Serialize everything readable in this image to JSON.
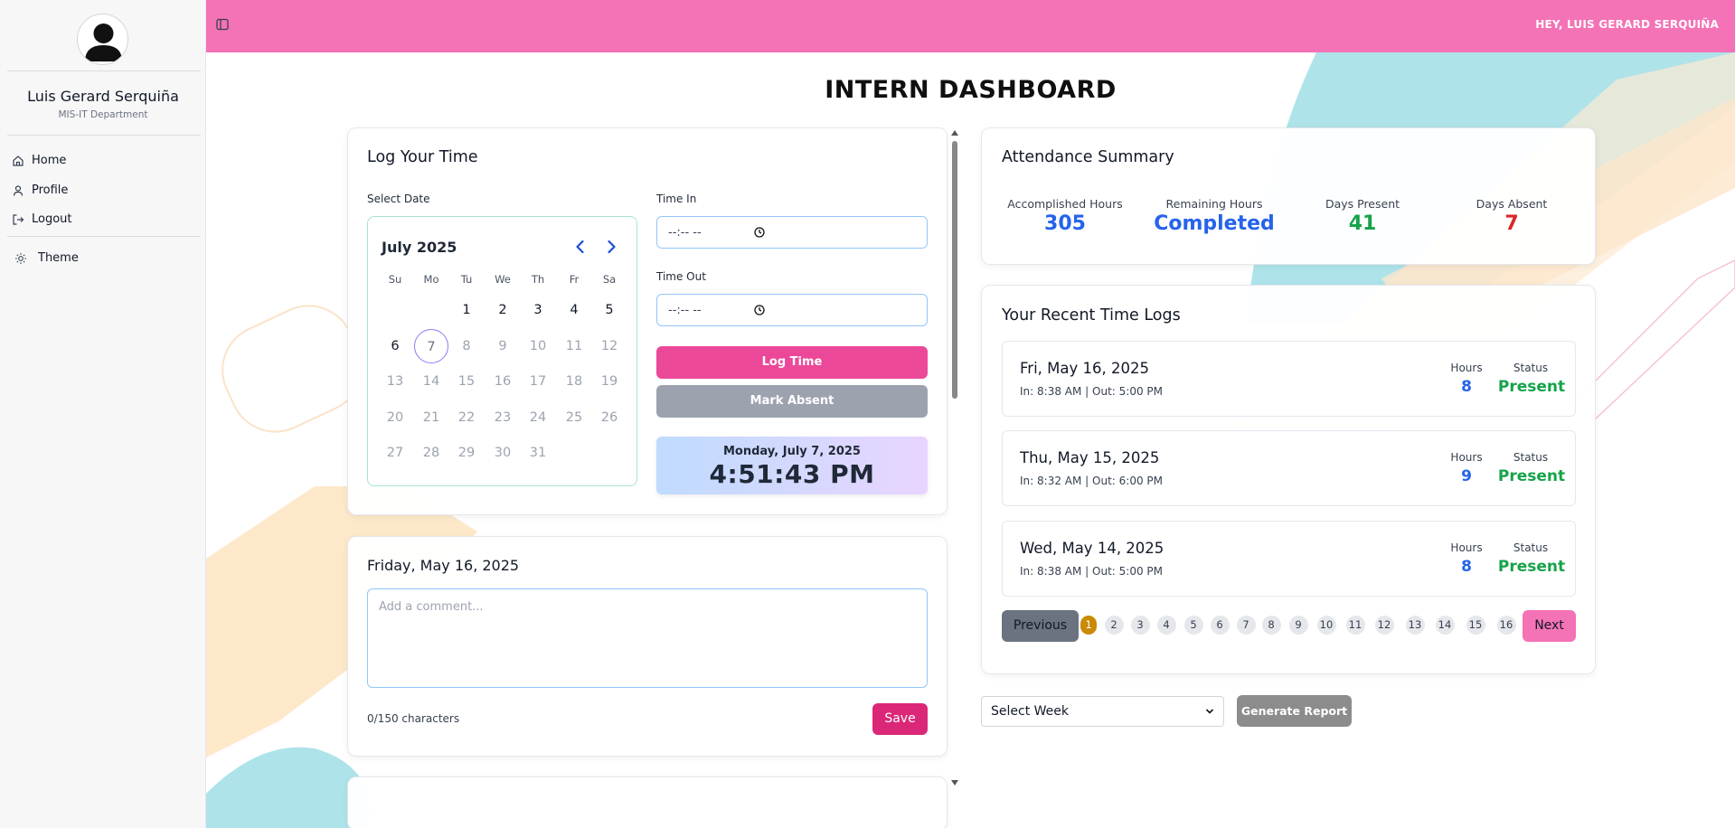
{
  "sidebar": {
    "user_name": "Luis Gerard Serquiña",
    "department": "MIS-IT Department",
    "nav": [
      {
        "label": "Home",
        "icon": "home-icon"
      },
      {
        "label": "Profile",
        "icon": "user-icon"
      },
      {
        "label": "Logout",
        "icon": "logout-icon"
      }
    ],
    "theme_label": "Theme"
  },
  "header": {
    "greeting": "HEY, LUIS GERARD SERQUIÑA",
    "bar_color": "#f472b6"
  },
  "page_title": "INTERN DASHBOARD",
  "log_time": {
    "title": "Log Your Time",
    "select_date_label": "Select Date",
    "calendar": {
      "month_label": "July 2025",
      "weekdays": [
        "Su",
        "Mo",
        "Tu",
        "We",
        "Th",
        "Fr",
        "Sa"
      ],
      "weeks": [
        [
          "",
          "",
          "1",
          "2",
          "3",
          "4",
          "5"
        ],
        [
          "6",
          "7",
          "8",
          "9",
          "10",
          "11",
          "12"
        ],
        [
          "13",
          "14",
          "15",
          "16",
          "17",
          "18",
          "19"
        ],
        [
          "20",
          "21",
          "22",
          "23",
          "24",
          "25",
          "26"
        ],
        [
          "27",
          "28",
          "29",
          "30",
          "31",
          "",
          ""
        ]
      ],
      "selected_day": "7"
    },
    "time_in_label": "Time In",
    "time_in_value": "--:-- --",
    "time_out_label": "Time Out",
    "time_out_value": "--:-- --",
    "log_button": "Log Time",
    "absent_button": "Mark Absent",
    "clock_date": "Monday, July 7, 2025",
    "clock_time": "4:51:43 PM"
  },
  "comment_card": {
    "title": "Friday, May 16, 2025",
    "placeholder": "Add a comment...",
    "char_count": "0/150 characters",
    "save_button": "Save"
  },
  "attendance": {
    "title": "Attendance Summary",
    "stats": [
      {
        "label": "Accomplished Hours",
        "value": "305",
        "color": "#2563eb"
      },
      {
        "label": "Remaining Hours",
        "value": "Completed",
        "color": "#2563eb"
      },
      {
        "label": "Days Present",
        "value": "41",
        "color": "#16a34a"
      },
      {
        "label": "Days Absent",
        "value": "7",
        "color": "#dc2626"
      }
    ]
  },
  "recent_logs": {
    "title": "Your Recent Time Logs",
    "hours_label": "Hours",
    "status_label": "Status",
    "items": [
      {
        "date": "Fri, May 16, 2025",
        "in_label": "In:",
        "in": "8:38 AM",
        "out_label": "Out:",
        "out": "5:00 PM",
        "hours": "8",
        "status": "Present"
      },
      {
        "date": "Thu, May 15, 2025",
        "in_label": "In:",
        "in": "8:32 AM",
        "out_label": "Out:",
        "out": "6:00 PM",
        "hours": "9",
        "status": "Present"
      },
      {
        "date": "Wed, May 14, 2025",
        "in_label": "In:",
        "in": "8:38 AM",
        "out_label": "Out:",
        "out": "5:00 PM",
        "hours": "8",
        "status": "Present"
      }
    ],
    "pagination": {
      "previous": "Previous",
      "next": "Next",
      "pages": [
        "1",
        "2",
        "3",
        "4",
        "5",
        "6",
        "7",
        "8",
        "9",
        "10",
        "11",
        "12",
        "13",
        "14",
        "15",
        "16"
      ],
      "current": "1"
    }
  },
  "report": {
    "select_week": "Select Week",
    "generate_button": "Generate Report"
  }
}
